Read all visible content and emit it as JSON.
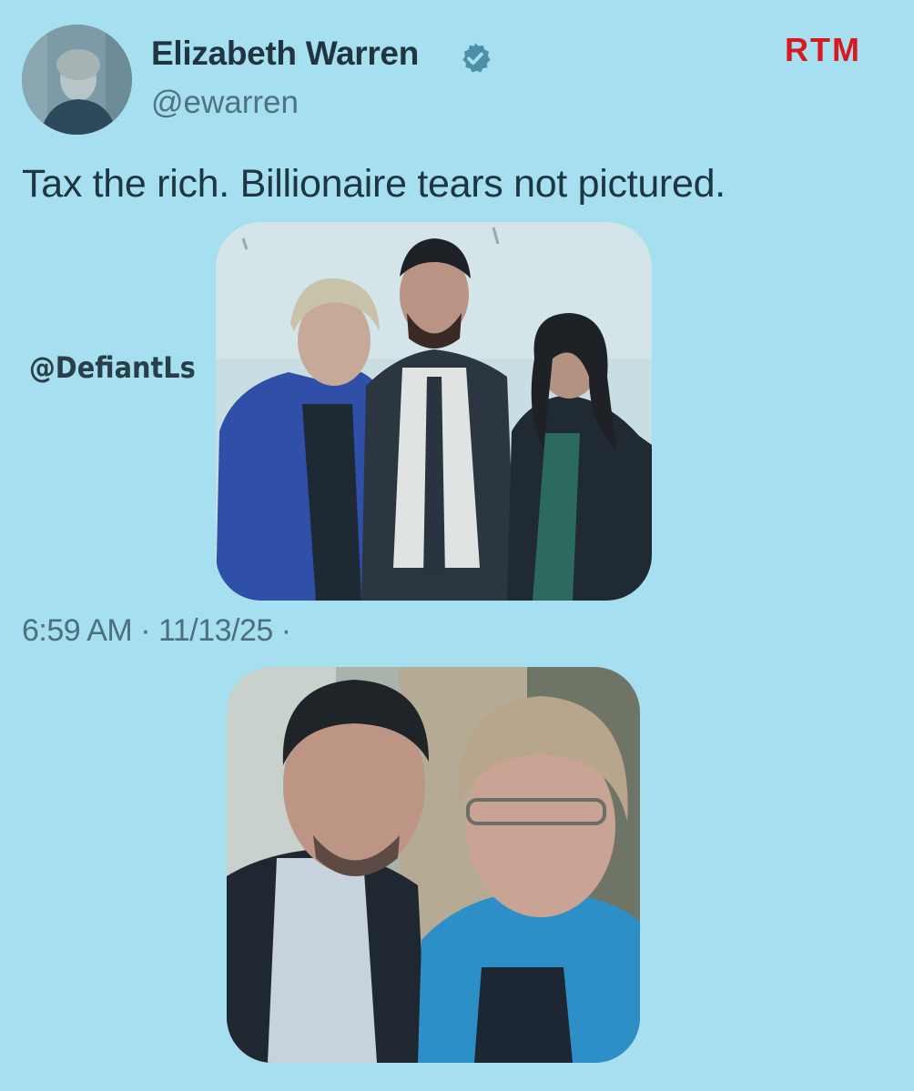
{
  "tweet": {
    "display_name": "Elizabeth Warren",
    "handle": "@ewarren",
    "text": "Tax the rich. Billionaire tears not pictured.",
    "timestamp": "6:59 AM · 11/13/25 ·",
    "verified_icon": "verified-badge-icon",
    "avatar_icon": "profile-photo"
  },
  "brand": {
    "label": "RTM",
    "color": "#d71920"
  },
  "watermark": {
    "label": "@DefiantLs"
  },
  "colors": {
    "background": "#a6dff0",
    "verified": "#4c8fa6"
  }
}
